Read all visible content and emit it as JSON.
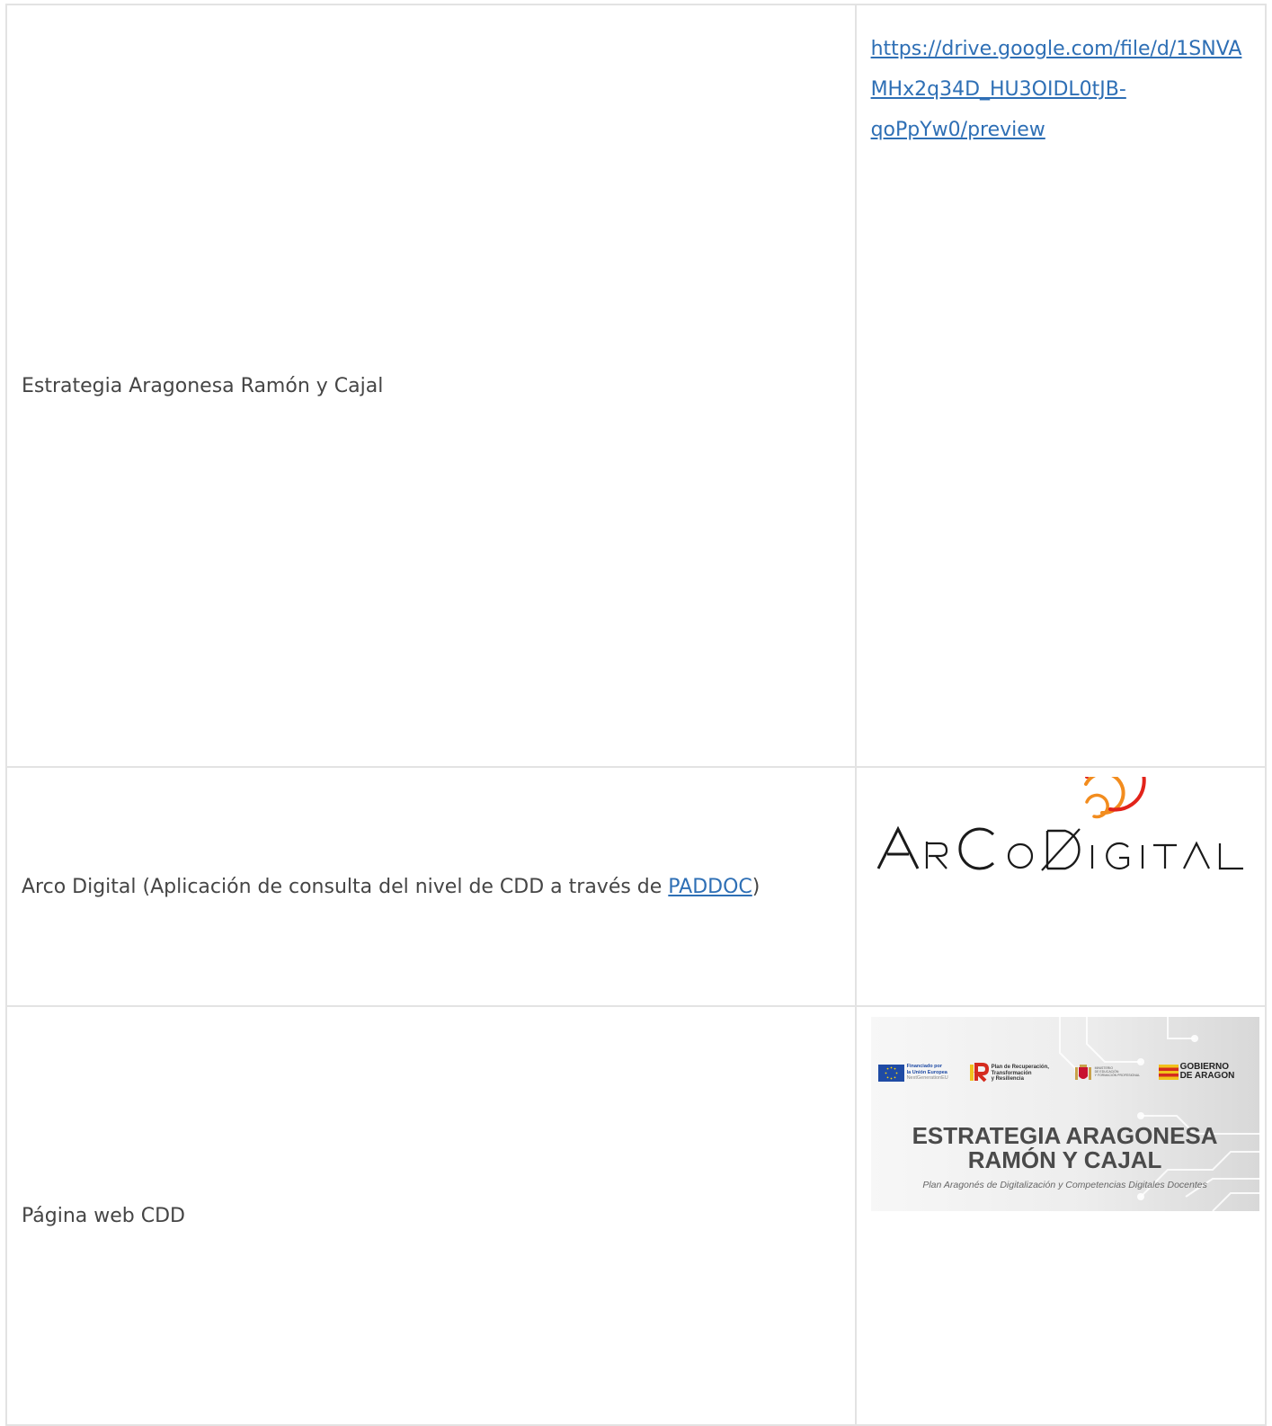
{
  "rows": [
    {
      "label": "Estrategia Aragonesa Ramón y Cajal",
      "link_lines": [
        "https://drive.google.com/file/d/1SNVA",
        "MHx2q34D_HU3OIDL0tJB-",
        "qoPpYw0/preview"
      ]
    },
    {
      "label_before": "Arco Digital (Aplicación de consulta del nivel de CDD a través de ",
      "label_link": "PADDOC",
      "label_after": ")",
      "logo_text": "ArCo DIGITAL"
    },
    {
      "label": "Página web CDD",
      "banner": {
        "eu_line1": "Financiado por",
        "eu_line2": "la Unión Europea",
        "eu_line3": "NextGenerationEU",
        "prtr_line1": "Plan de Recuperación,",
        "prtr_line2": "Transformación",
        "prtr_line3": "y Resiliencia",
        "ministry_line1": "MINISTERIO",
        "ministry_line2": "DE EDUCACIÓN",
        "ministry_line3": "Y FORMACIÓN PROFESIONAL",
        "gob_line1": "GOBIERNO",
        "gob_line2": "DE ARAGON",
        "title_line1": "ESTRATEGIA ARAGONESA",
        "title_line2": "RAMÓN Y CAJAL",
        "subtitle": "Plan Aragonés de Digitalización y Competencias Digitales Docentes"
      }
    }
  ],
  "colors": {
    "link": "#2e6fb5",
    "text": "#454545",
    "border": "#e3e3e3",
    "logo_orange": "#f28c1e",
    "logo_red": "#e2231a"
  }
}
